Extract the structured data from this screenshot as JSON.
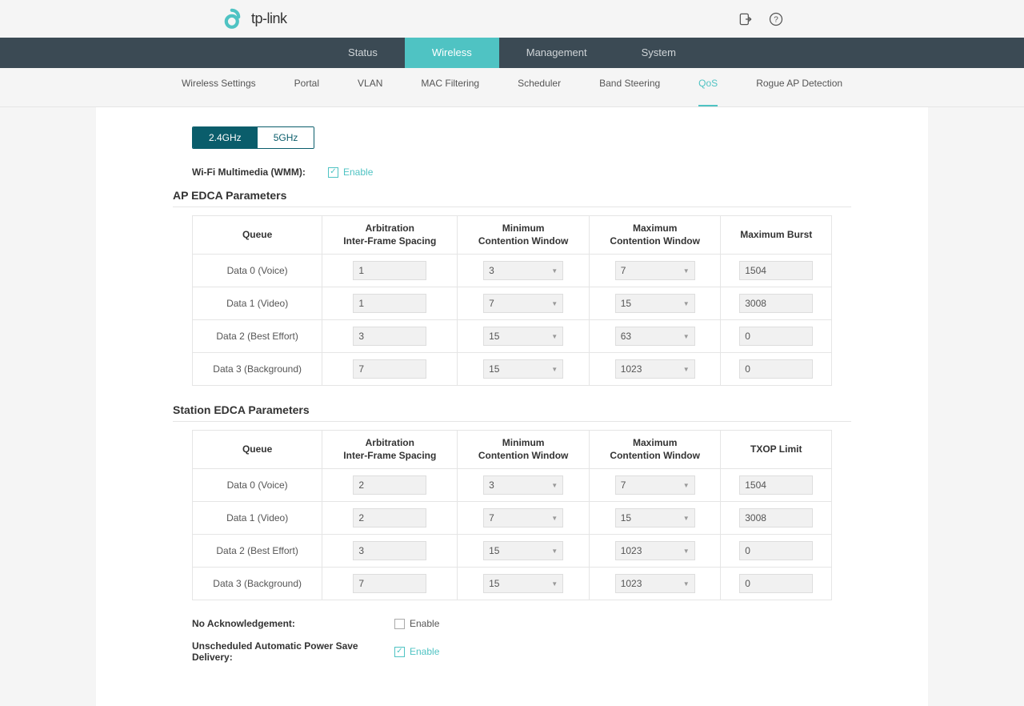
{
  "brand": "tp-link",
  "mainNav": [
    "Status",
    "Wireless",
    "Management",
    "System"
  ],
  "mainNavActive": 1,
  "subNav": [
    "Wireless Settings",
    "Portal",
    "VLAN",
    "MAC Filtering",
    "Scheduler",
    "Band Steering",
    "QoS",
    "Rogue AP Detection"
  ],
  "subNavActive": 6,
  "bandTabs": [
    "2.4GHz",
    "5GHz"
  ],
  "bandActive": 0,
  "wmm": {
    "label": "Wi-Fi Multimedia (WMM):",
    "enableLabel": "Enable",
    "checked": true
  },
  "apSection": {
    "title": "AP EDCA Parameters",
    "headers": {
      "queue": "Queue",
      "aifs_l1": "Arbitration",
      "aifs_l2": "Inter-Frame Spacing",
      "cwmin_l1": "Minimum",
      "cwmin_l2": "Contention Window",
      "cwmax_l1": "Maximum",
      "cwmax_l2": "Contention Window",
      "burst": "Maximum Burst"
    },
    "rows": [
      {
        "q": "Data 0 (Voice)",
        "aifs": "1",
        "cwmin": "3",
        "cwmax": "7",
        "burst": "1504"
      },
      {
        "q": "Data 1 (Video)",
        "aifs": "1",
        "cwmin": "7",
        "cwmax": "15",
        "burst": "3008"
      },
      {
        "q": "Data 2 (Best Effort)",
        "aifs": "3",
        "cwmin": "15",
        "cwmax": "63",
        "burst": "0"
      },
      {
        "q": "Data 3 (Background)",
        "aifs": "7",
        "cwmin": "15",
        "cwmax": "1023",
        "burst": "0"
      }
    ]
  },
  "staSection": {
    "title": "Station EDCA Parameters",
    "headers": {
      "queue": "Queue",
      "aifs_l1": "Arbitration",
      "aifs_l2": "Inter-Frame Spacing",
      "cwmin_l1": "Minimum",
      "cwmin_l2": "Contention Window",
      "cwmax_l1": "Maximum",
      "cwmax_l2": "Contention Window",
      "txop": "TXOP Limit"
    },
    "rows": [
      {
        "q": "Data 0 (Voice)",
        "aifs": "2",
        "cwmin": "3",
        "cwmax": "7",
        "txop": "1504"
      },
      {
        "q": "Data 1 (Video)",
        "aifs": "2",
        "cwmin": "7",
        "cwmax": "15",
        "txop": "3008"
      },
      {
        "q": "Data 2 (Best Effort)",
        "aifs": "3",
        "cwmin": "15",
        "cwmax": "1023",
        "txop": "0"
      },
      {
        "q": "Data 3 (Background)",
        "aifs": "7",
        "cwmin": "15",
        "cwmax": "1023",
        "txop": "0"
      }
    ]
  },
  "noAck": {
    "label": "No Acknowledgement:",
    "enableLabel": "Enable",
    "checked": false
  },
  "uapsd": {
    "label": "Unscheduled Automatic Power Save Delivery:",
    "enableLabel": "Enable",
    "checked": true
  }
}
